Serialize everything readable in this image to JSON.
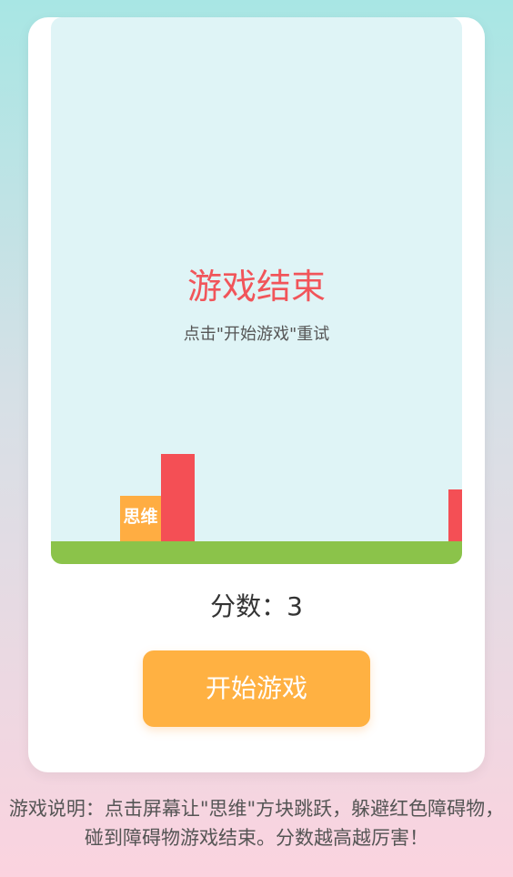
{
  "game": {
    "player_label": "思维",
    "game_over_title": "游戏结束",
    "game_over_hint": "点击\"开始游戏\"重试"
  },
  "score": {
    "label": "分数：3",
    "value": 3
  },
  "controls": {
    "start_label": "开始游戏"
  },
  "instructions": {
    "text": "游戏说明：点击屏幕让\"思维\"方块跳跃，躲避红色障碍物，碰到障碍物游戏结束。分数越高越厉害！"
  },
  "colors": {
    "sky": "#dff4f6",
    "ground": "#8bc34a",
    "player": "#ffad42",
    "obstacle": "#f44f55",
    "title": "#f1555a",
    "button": "#ffb142"
  }
}
